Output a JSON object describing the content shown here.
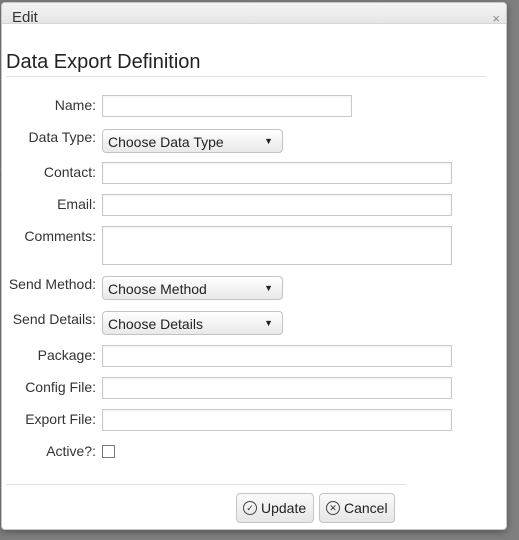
{
  "dialog": {
    "title": "Edit",
    "heading": "Data Export Definition"
  },
  "fields": {
    "name_label": "Name:",
    "data_type_label": "Data Type:",
    "data_type_value": "Choose Data Type",
    "contact_label": "Contact:",
    "email_label": "Email:",
    "comments_label": "Comments:",
    "send_method_label": "Send Method:",
    "send_method_value": "Choose Method",
    "send_details_label": "Send Details:",
    "send_details_value": "Choose Details",
    "package_label": "Package:",
    "config_file_label": "Config File:",
    "export_file_label": "Export File:",
    "active_label": "Active?:"
  },
  "buttons": {
    "update": "Update",
    "cancel": "Cancel"
  },
  "icons": {
    "close": "close-icon",
    "dropdown": "chevron-down-icon",
    "update": "check-circle-icon",
    "cancel": "x-circle-icon"
  }
}
